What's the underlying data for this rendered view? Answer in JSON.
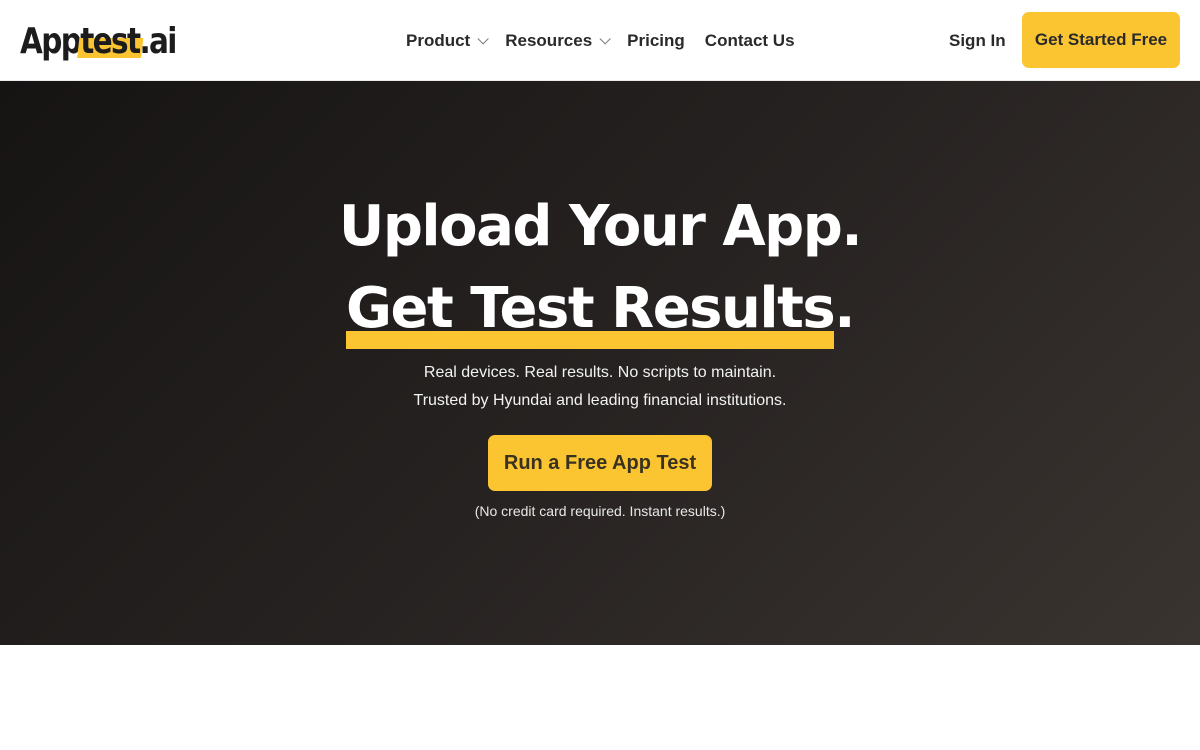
{
  "navbar": {
    "logo": {
      "part1": "App",
      "part2": "test",
      "part3": ".ai"
    },
    "links": [
      {
        "label": "Product",
        "has_dropdown": true
      },
      {
        "label": "Resources",
        "has_dropdown": true
      },
      {
        "label": "Pricing",
        "has_dropdown": false
      },
      {
        "label": "Contact Us",
        "has_dropdown": false
      }
    ],
    "sign_in": "Sign In",
    "cta": "Get Started Free"
  },
  "hero": {
    "title_line1": "Upload Your App.",
    "title_line2_highlight": "Get Test Results",
    "title_line2_end": ".",
    "subtitle_line1": "Real devices. Real results. No scripts to maintain.",
    "subtitle_line2": "Trusted by Hyundai and leading financial institutions.",
    "cta": "Run a Free App Test",
    "note": "(No credit card required. Instant results.)"
  },
  "colors": {
    "accent": "#fbc531",
    "hero_background": "#231f1d",
    "text_dark": "#2a2a2a"
  }
}
